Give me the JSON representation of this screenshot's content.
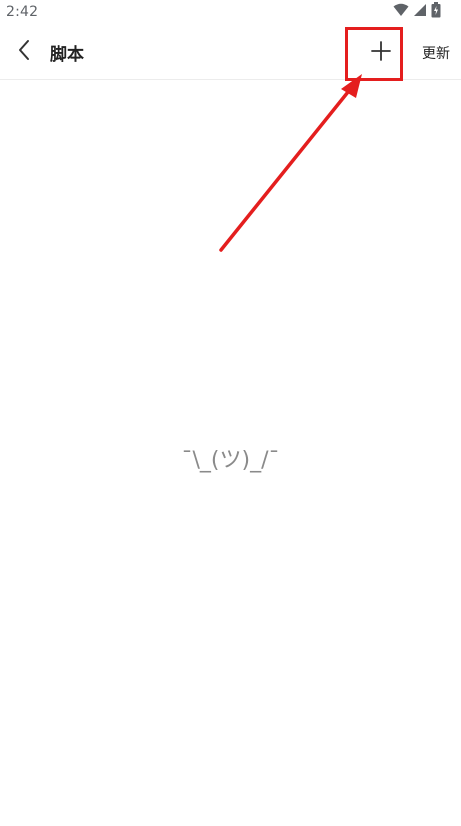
{
  "status_bar": {
    "time": "2:42",
    "icons": [
      "wifi-icon",
      "cell-signal-icon",
      "battery-icon"
    ]
  },
  "toolbar": {
    "back_icon": "back-chevron-icon",
    "title": "脚本",
    "add_icon": "plus-icon",
    "update_label": "更新"
  },
  "empty_state": {
    "text": "¯\\_(ツ)_/¯"
  },
  "annotation": {
    "color": "#e41e1e",
    "target": "add-button"
  }
}
